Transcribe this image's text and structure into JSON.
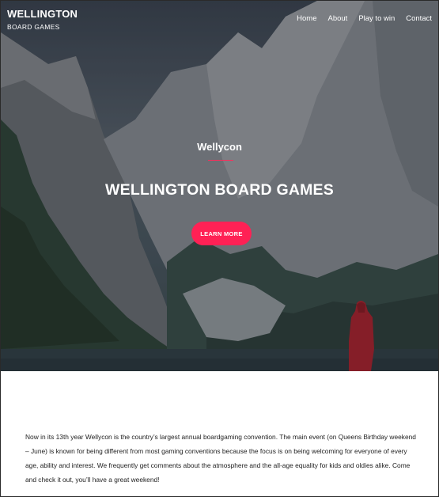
{
  "header": {
    "brand_name": "WELLINGTON",
    "brand_sub": "BOARD GAMES",
    "nav": [
      {
        "label": "Home"
      },
      {
        "label": "About"
      },
      {
        "label": "Play to win"
      },
      {
        "label": "Contact"
      }
    ]
  },
  "hero": {
    "eyebrow": "Wellycon",
    "headline": "WELLINGTON BOARD GAMES",
    "cta_label": "LEARN MORE"
  },
  "content": {
    "paragraph": "Now in its 13th year Wellycon is the country’s largest annual boardgaming convention.  The main event (on Queens Birthday weekend – June) is known for being different from most gaming conventions because the focus is on being welcoming for everyone of every age, ability and interest.  We frequently get comments about the atmosphere and the all-age equality for kids and oldies alike.  Come and check it out, you’ll have a great weekend!"
  },
  "colors": {
    "accent": "#ff2155",
    "text": "#222222"
  }
}
